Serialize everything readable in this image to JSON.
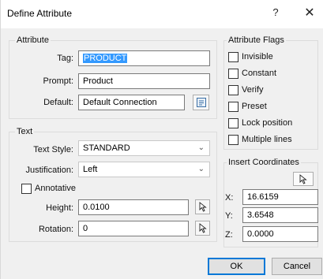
{
  "window": {
    "title": "Define Attribute",
    "help_glyph": "?",
    "close_glyph": "✕"
  },
  "attribute": {
    "group_label": "Attribute",
    "tag_label": "Tag:",
    "tag_value": "PRODUCT",
    "prompt_label": "Prompt:",
    "prompt_value": "Product",
    "default_label": "Default:",
    "default_value": "Default Connection"
  },
  "text": {
    "group_label": "Text",
    "style_label": "Text Style:",
    "style_value": "STANDARD",
    "justification_label": "Justification:",
    "justification_value": "Left",
    "annotative_label": "Annotative",
    "annotative_checked": false,
    "height_label": "Height:",
    "height_value": "0.0100",
    "rotation_label": "Rotation:",
    "rotation_value": "0"
  },
  "flags": {
    "group_label": "Attribute Flags",
    "items": [
      {
        "label": "Invisible",
        "checked": false
      },
      {
        "label": "Constant",
        "checked": false
      },
      {
        "label": "Verify",
        "checked": false
      },
      {
        "label": "Preset",
        "checked": false
      },
      {
        "label": "Lock position",
        "checked": false
      },
      {
        "label": "Multiple lines",
        "checked": false
      }
    ]
  },
  "insert": {
    "group_label": "Insert Coordinates",
    "x_label": "X:",
    "x_value": "16.6159",
    "y_label": "Y:",
    "y_value": "3.6548",
    "z_label": "Z:",
    "z_value": "0.0000"
  },
  "buttons": {
    "ok": "OK",
    "cancel": "Cancel"
  },
  "icons": {
    "field_button": "field-insert-icon",
    "pick_point": "pick-point-cursor-icon",
    "combo_arrow": "chevron-down-icon"
  }
}
